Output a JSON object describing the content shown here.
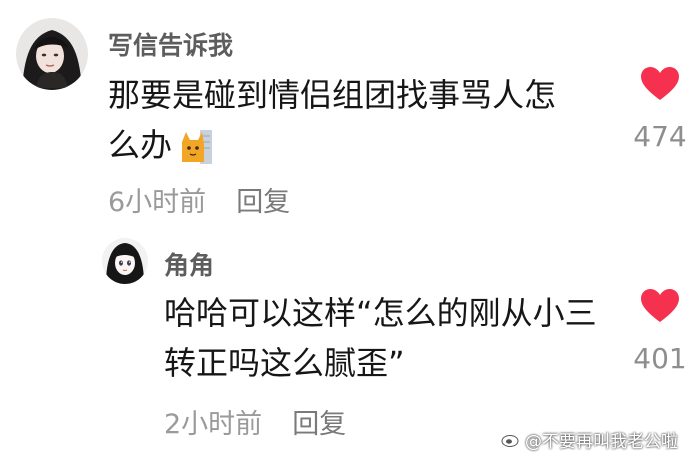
{
  "comments": [
    {
      "username": "写信告诉我",
      "text_line1": "那要是碰到情侣组团找事骂人怎",
      "text_line2": "么办",
      "time": "6小时前",
      "reply_label": "回复",
      "like_count": "474",
      "emoji_icon": "cat-emoji-icon"
    }
  ],
  "replies": [
    {
      "username": "角角",
      "text_line1": "哈哈可以这样“怎么的刚从小三",
      "text_line2": "转正吗这么腻歪”",
      "time": "2小时前",
      "reply_label": "回复",
      "like_count": "401"
    }
  ],
  "watermark": "@不要再叫我老公啦",
  "colors": {
    "heart": "#f5314f",
    "meta": "#9a9a9a",
    "username": "#5d5d5d",
    "text": "#161616"
  },
  "icons": {
    "like": "heart-icon",
    "watermark": "weibo-icon"
  }
}
